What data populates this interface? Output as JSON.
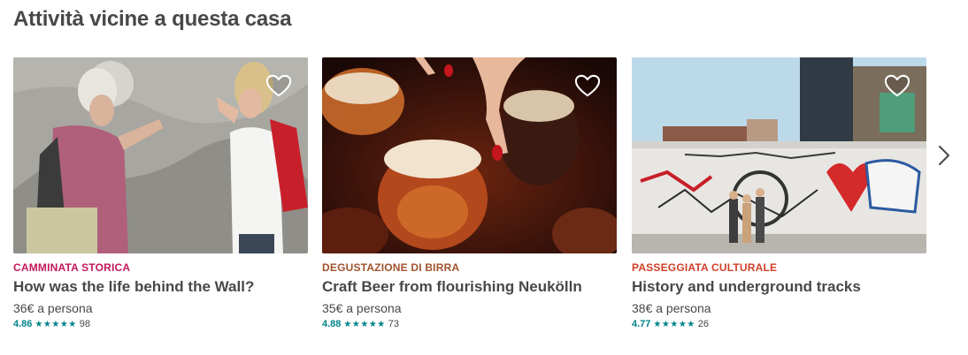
{
  "section": {
    "title": "Attività vicine a questa casa"
  },
  "cards": [
    {
      "category": "CAMMINATA STORICA",
      "category_color": "#C2185B",
      "title": "How was the life behind the Wall?",
      "price": "36€ a persona",
      "rating": "4.86",
      "stars": "★★★★★",
      "reviews": "98",
      "favorite_icon": "heart-outline-icon"
    },
    {
      "category": "DEGUSTAZIONE DI BIRRA",
      "category_color": "#A0522D",
      "title": "Craft Beer from flourishing Neukölln",
      "price": "35€ a persona",
      "rating": "4.88",
      "stars": "★★★★★",
      "reviews": "73",
      "favorite_icon": "heart-outline-icon"
    },
    {
      "category": "PASSEGGIATA CULTURALE",
      "category_color": "#D1402A",
      "title": "History and underground tracks",
      "price": "38€ a persona",
      "rating": "4.77",
      "stars": "★★★★★",
      "reviews": "26",
      "favorite_icon": "heart-outline-icon"
    }
  ],
  "navigation": {
    "next_icon": "chevron-right-icon"
  },
  "colors": {
    "rating_teal": "#008489",
    "text_dark": "#484848"
  }
}
